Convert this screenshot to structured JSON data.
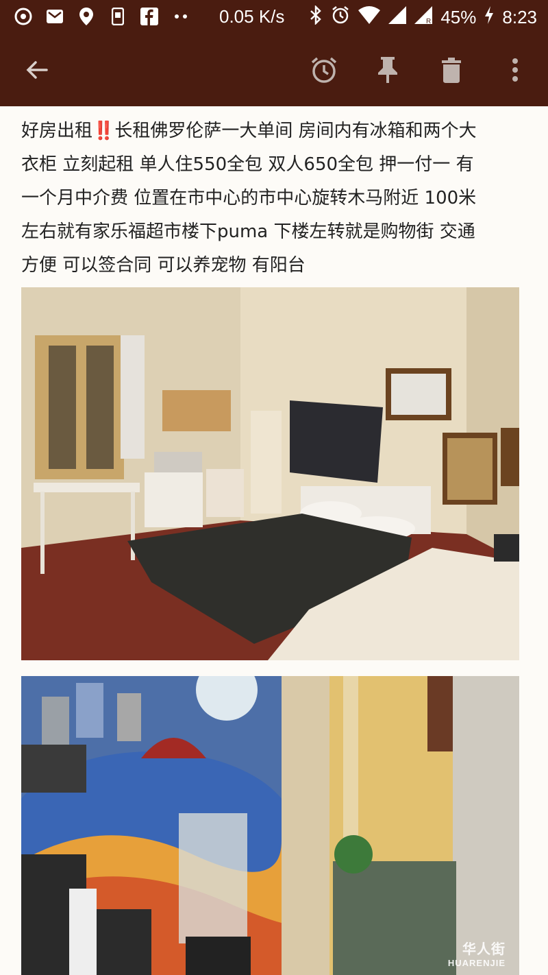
{
  "status_bar": {
    "net_speed": "0.05 K/s",
    "battery": "45%",
    "time": "8:23",
    "icons": [
      "netease-icon",
      "mail-icon",
      "location-icon",
      "phone-icon",
      "facebook-icon",
      "more-dots-icon",
      "bluetooth-icon",
      "alarm-icon",
      "wifi-icon",
      "signal-icon",
      "signal-r-icon",
      "charging-icon"
    ]
  },
  "toolbar": {
    "back_icon": "back-arrow-icon",
    "actions": [
      "alarm-icon",
      "pin-icon",
      "trash-icon",
      "overflow-menu-icon"
    ]
  },
  "post": {
    "lines": [
      "好房出租‼️长租佛罗伦萨一大单间 房间内有冰箱和两个大",
      "衣柜  立刻起租 单人住550全包 双人650全包 押一付一  有",
      "一个月中介费 位置在市中心的市中心旋转木马附近 100米",
      "左右就有家乐福超市楼下puma 下楼左转就是购物街 交通",
      "方便 可以签合同 可以养宠物 有阳台"
    ]
  },
  "watermark": {
    "script": "华人街",
    "latin": "HUARENJIE"
  },
  "colors": {
    "header_bg": "#4a1c10",
    "page_bg": "#fdfbf7",
    "text": "#222222"
  }
}
